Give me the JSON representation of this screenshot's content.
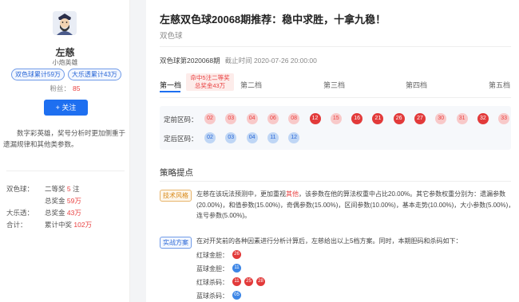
{
  "author": {
    "name": "左慈",
    "title": "小炮英雄",
    "badges": [
      "双色球累计59万",
      "大乐透累计43万"
    ],
    "fans_label": "粉丝：",
    "fans_count": "85",
    "follow_label": "+ 关注",
    "intro": "数字彩英雄，奖号分析时更加侧重于遗漏规律和其他类参数。"
  },
  "stats": {
    "rows": [
      {
        "label": "双色球：",
        "pre": "二等奖",
        "value": "5",
        "post": "注"
      },
      {
        "label": "",
        "pre": "总奖金",
        "value": "59万",
        "post": ""
      },
      {
        "label": "大乐透：",
        "pre": "总奖金",
        "value": "43万",
        "post": ""
      },
      {
        "label": "合计：",
        "pre": "累计中奖",
        "value": "102万",
        "post": ""
      }
    ]
  },
  "article": {
    "title": "左慈双色球20068期推荐：稳中求胜，十拿九稳！",
    "category": "双色球",
    "issue": "双色球第2020068期",
    "deadline": "截止时间 2020-07-26 20:00:00"
  },
  "tabs": [
    {
      "label": "第一档",
      "active": true
    },
    {
      "label": "第二档",
      "active": false
    },
    {
      "label": "第三档",
      "active": false
    },
    {
      "label": "第四档",
      "active": false
    },
    {
      "label": "第五档",
      "active": false
    }
  ],
  "hit_note": {
    "line1": "命中5注二等奖",
    "line2": "总奖金43万"
  },
  "red_zone": {
    "label": "定前区码：",
    "balls": [
      {
        "n": "02",
        "hit": false
      },
      {
        "n": "03",
        "hit": false
      },
      {
        "n": "04",
        "hit": false
      },
      {
        "n": "06",
        "hit": false
      },
      {
        "n": "08",
        "hit": false
      },
      {
        "n": "12",
        "hit": true
      },
      {
        "n": "15",
        "hit": false
      },
      {
        "n": "16",
        "hit": true
      },
      {
        "n": "21",
        "hit": true
      },
      {
        "n": "26",
        "hit": true
      },
      {
        "n": "27",
        "hit": true
      },
      {
        "n": "30",
        "hit": false
      },
      {
        "n": "31",
        "hit": false
      },
      {
        "n": "32",
        "hit": true
      },
      {
        "n": "33",
        "hit": false
      }
    ]
  },
  "blue_zone": {
    "label": "定后区码：",
    "balls": [
      "02",
      "03",
      "04",
      "11",
      "12"
    ]
  },
  "strategy": {
    "title": "策略提点",
    "tech_tag": "技术风格",
    "tech_text_before": "左慈在该玩法预测中，更加重视",
    "tech_text_highlight": "其他",
    "tech_text_after": "，该参数在他的算法权重中占比20.00%。其它参数权重分别为：遗漏参数(20.00%)，和值参数(15.00%)，奇偶参数(15.00%)，区间参数(10.00%)，基本走势(10.00%)，大小参数(5.00%)，连号参数(5.00%)。",
    "plan_tag": "实战方案",
    "plan_text": "在对开奖前的各种因素进行分析计算后，左慈给出以上5档方案。同时，本期胆码和杀码如下：",
    "picks": [
      {
        "label": "红球金胆：",
        "balls": [
          "26"
        ],
        "color": "r"
      },
      {
        "label": "蓝球金胆：",
        "balls": [
          "11"
        ],
        "color": "b"
      },
      {
        "label": "红球杀码：",
        "balls": [
          "11",
          "25",
          "28"
        ],
        "color": "r"
      },
      {
        "label": "蓝球杀码：",
        "balls": [
          "05"
        ],
        "color": "b"
      }
    ]
  }
}
